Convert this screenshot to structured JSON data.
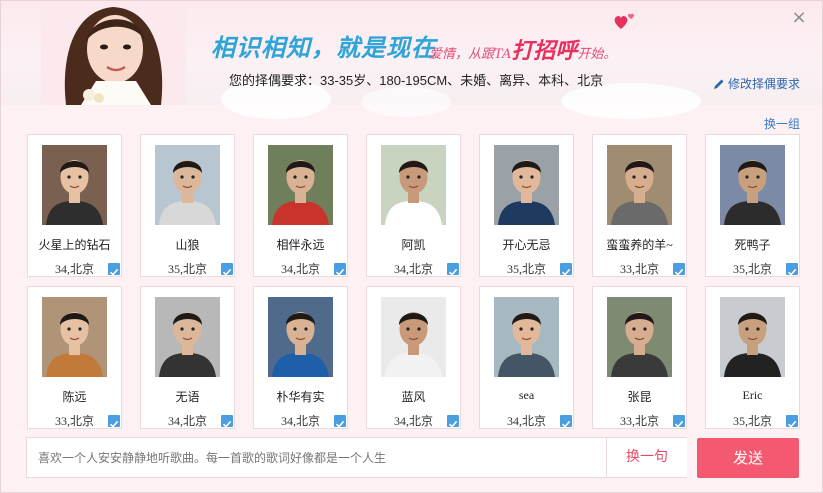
{
  "header": {
    "slogan": "相识相知，就是现在",
    "slogan_sub_prefix": "爱情，从跟TA",
    "slogan_sub_emph": "打招呼",
    "slogan_sub_suffix": "开始。",
    "requirement": "您的择偶要求：33-35岁、180-195CM、未婚、离异、本科、北京",
    "modify_label": "修改择偶要求",
    "close_glyph": "×"
  },
  "swap_group_label": "换一组",
  "colors": {
    "accent": "#f35a72",
    "link": "#2a66b0",
    "check": "#4b9fe0"
  },
  "profiles": [
    {
      "name": "火星上的钻石",
      "info": "34,北京",
      "checked": true
    },
    {
      "name": "山狼",
      "info": "35,北京",
      "checked": true
    },
    {
      "name": "相伴永远",
      "info": "34,北京",
      "checked": true
    },
    {
      "name": "阿凯",
      "info": "34,北京",
      "checked": true
    },
    {
      "name": "开心无忌",
      "info": "35,北京",
      "checked": true
    },
    {
      "name": "蛮蛮养的羊~",
      "info": "33,北京",
      "checked": true
    },
    {
      "name": "死鸭子",
      "info": "35,北京",
      "checked": true
    },
    {
      "name": "陈远",
      "info": "33,北京",
      "checked": true
    },
    {
      "name": "无语",
      "info": "34,北京",
      "checked": true
    },
    {
      "name": "朴华有实",
      "info": "34,北京",
      "checked": true
    },
    {
      "name": "蓝风",
      "info": "34,北京",
      "checked": true
    },
    {
      "name": "sea",
      "info": "34,北京",
      "checked": true
    },
    {
      "name": "张昆",
      "info": "33,北京",
      "checked": true
    },
    {
      "name": "Eric",
      "info": "35,北京",
      "checked": true
    }
  ],
  "message": {
    "text": "喜欢一个人安安静静地听歌曲。每一首歌的歌词好像都是一个人生",
    "swap_label": "换一句",
    "send_label": "发送"
  }
}
